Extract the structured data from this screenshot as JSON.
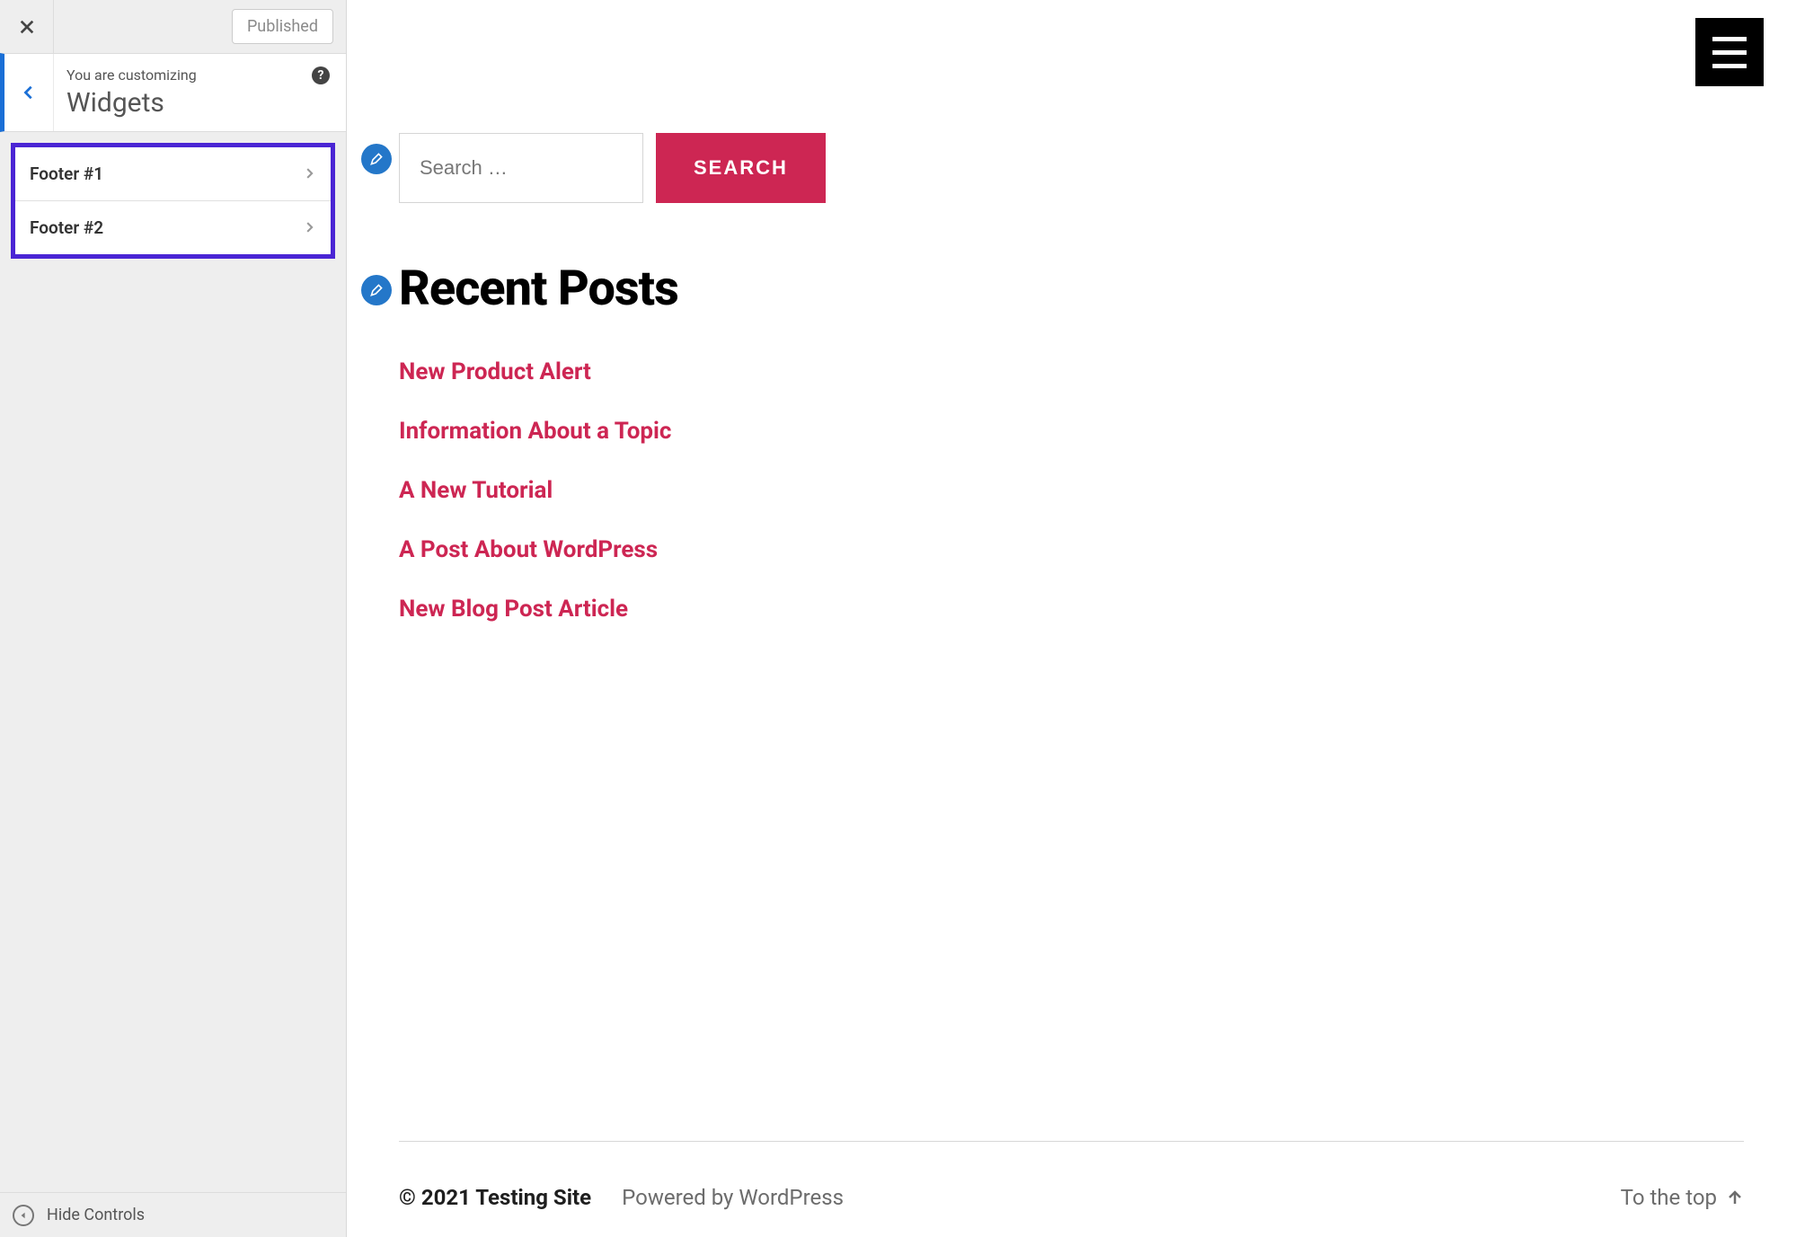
{
  "sidebar": {
    "publish_status": "Published",
    "header": {
      "subtitle": "You are customizing",
      "title": "Widgets"
    },
    "widget_areas": [
      {
        "label": "Footer #1"
      },
      {
        "label": "Footer #2"
      }
    ],
    "hide_controls_label": "Hide Controls"
  },
  "preview": {
    "search": {
      "placeholder": "Search …",
      "button_label": "SEARCH"
    },
    "recent_posts": {
      "heading": "Recent Posts",
      "items": [
        "New Product Alert",
        "Information About a Topic",
        "A New Tutorial",
        "A Post About WordPress",
        "New Blog Post Article"
      ]
    },
    "footer": {
      "copyright": "© 2021 Testing Site",
      "powered": "Powered by WordPress",
      "to_top": "To the top"
    }
  }
}
